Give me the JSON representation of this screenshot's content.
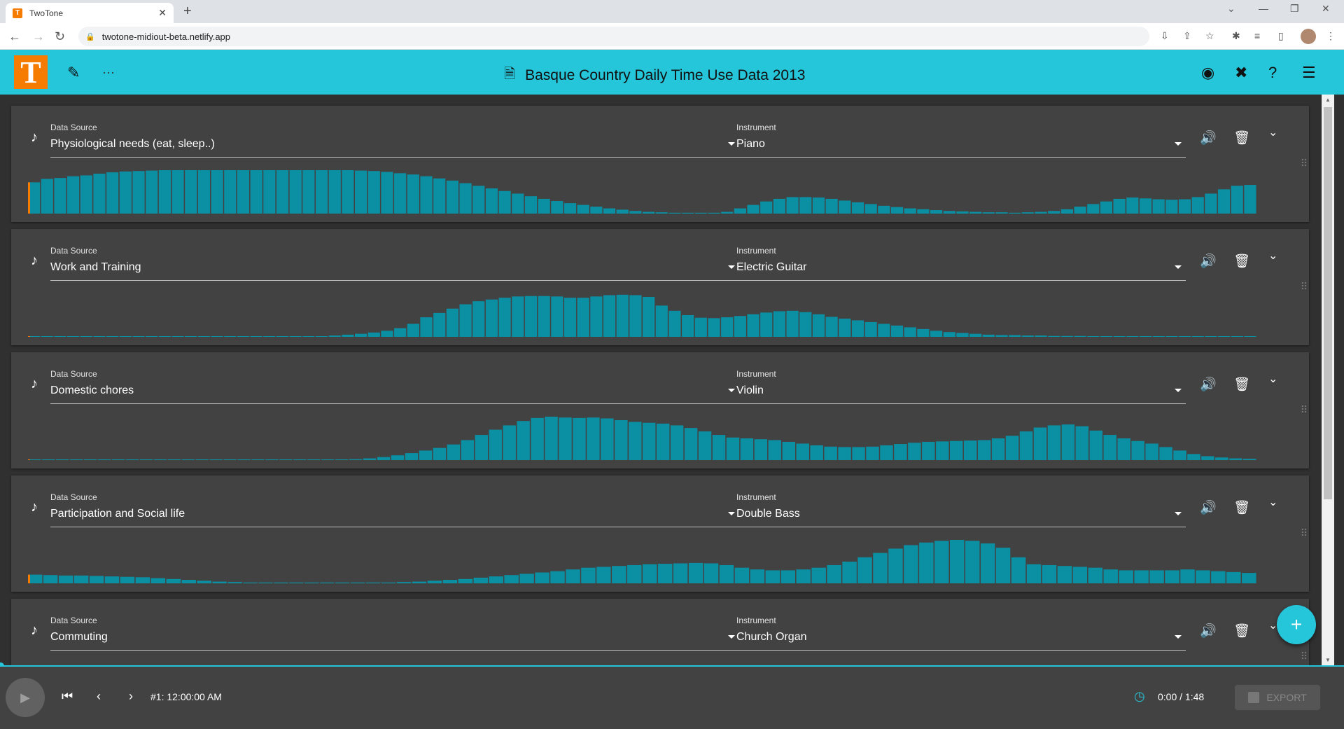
{
  "browser": {
    "tab_title": "TwoTone",
    "favicon_letter": "T",
    "url": "twotone-midiout-beta.netlify.app"
  },
  "app": {
    "title": "Basque Country Daily Time Use Data 2013",
    "accent_color": "#26c6da",
    "logo_color": "#f57c00",
    "bar_color": "#0b8fa3",
    "more_label": "···"
  },
  "tracks": [
    {
      "data_source_label": "Data Source",
      "data_source": "Physiological needs (eat, sleep..)",
      "instrument_label": "Instrument",
      "instrument": "Piano",
      "values": [
        0.72,
        0.8,
        0.82,
        0.86,
        0.88,
        0.92,
        0.95,
        0.97,
        0.98,
        0.99,
        1,
        1,
        1,
        1,
        1,
        1,
        1,
        1,
        1,
        1,
        1,
        1,
        1,
        1,
        1,
        0.99,
        0.98,
        0.96,
        0.93,
        0.9,
        0.86,
        0.81,
        0.76,
        0.7,
        0.64,
        0.58,
        0.52,
        0.46,
        0.4,
        0.34,
        0.29,
        0.24,
        0.2,
        0.16,
        0.12,
        0.09,
        0.06,
        0.04,
        0.03,
        0.02,
        0.02,
        0.02,
        0.02,
        0.04,
        0.12,
        0.2,
        0.28,
        0.34,
        0.38,
        0.38,
        0.37,
        0.34,
        0.3,
        0.26,
        0.22,
        0.18,
        0.15,
        0.12,
        0.1,
        0.08,
        0.06,
        0.05,
        0.04,
        0.03,
        0.03,
        0.02,
        0.03,
        0.04,
        0.06,
        0.1,
        0.16,
        0.22,
        0.28,
        0.34,
        0.37,
        0.35,
        0.33,
        0.32,
        0.33,
        0.38,
        0.46,
        0.56,
        0.64,
        0.66
      ]
    },
    {
      "data_source_label": "Data Source",
      "data_source": "Work and Training",
      "instrument_label": "Instrument",
      "instrument": "Electric Guitar",
      "values": [
        0.01,
        0.01,
        0.01,
        0.01,
        0.01,
        0.01,
        0.01,
        0.01,
        0.01,
        0.01,
        0.01,
        0.01,
        0.01,
        0.01,
        0.01,
        0.01,
        0.01,
        0.01,
        0.01,
        0.01,
        0.01,
        0.01,
        0.01,
        0.03,
        0.05,
        0.07,
        0.1,
        0.14,
        0.2,
        0.3,
        0.45,
        0.55,
        0.65,
        0.75,
        0.82,
        0.86,
        0.9,
        0.93,
        0.94,
        0.94,
        0.93,
        0.9,
        0.9,
        0.93,
        0.96,
        0.97,
        0.96,
        0.92,
        0.72,
        0.6,
        0.5,
        0.44,
        0.43,
        0.45,
        0.48,
        0.52,
        0.56,
        0.59,
        0.6,
        0.57,
        0.52,
        0.46,
        0.42,
        0.38,
        0.34,
        0.3,
        0.26,
        0.22,
        0.18,
        0.14,
        0.11,
        0.09,
        0.07,
        0.05,
        0.04,
        0.04,
        0.03,
        0.03,
        0.02,
        0.02,
        0.02,
        0.01,
        0.01,
        0.01,
        0.01,
        0.01,
        0.01,
        0.01,
        0.01,
        0.01,
        0.01,
        0.01,
        0.01,
        0.01
      ]
    },
    {
      "data_source_label": "Data Source",
      "data_source": "Domestic chores",
      "instrument_label": "Instrument",
      "instrument": "Violin",
      "values": [
        0.01,
        0.01,
        0.01,
        0.01,
        0.01,
        0.01,
        0.01,
        0.01,
        0.01,
        0.01,
        0.01,
        0.01,
        0.01,
        0.01,
        0.01,
        0.01,
        0.01,
        0.01,
        0.01,
        0.01,
        0.01,
        0.01,
        0.01,
        0.02,
        0.04,
        0.07,
        0.11,
        0.16,
        0.22,
        0.28,
        0.36,
        0.46,
        0.58,
        0.7,
        0.8,
        0.9,
        0.97,
        1,
        0.98,
        0.97,
        0.98,
        0.96,
        0.92,
        0.88,
        0.86,
        0.84,
        0.8,
        0.74,
        0.66,
        0.58,
        0.52,
        0.5,
        0.48,
        0.46,
        0.42,
        0.38,
        0.34,
        0.31,
        0.3,
        0.3,
        0.31,
        0.34,
        0.37,
        0.4,
        0.42,
        0.43,
        0.44,
        0.45,
        0.46,
        0.5,
        0.56,
        0.66,
        0.75,
        0.8,
        0.82,
        0.78,
        0.68,
        0.58,
        0.5,
        0.44,
        0.38,
        0.3,
        0.22,
        0.14,
        0.09,
        0.06,
        0.04,
        0.03
      ]
    },
    {
      "data_source_label": "Data Source",
      "data_source": "Participation and Social life",
      "instrument_label": "Instrument",
      "instrument": "Double Bass",
      "values": [
        0.2,
        0.19,
        0.18,
        0.18,
        0.17,
        0.16,
        0.15,
        0.14,
        0.12,
        0.1,
        0.08,
        0.06,
        0.04,
        0.03,
        0.02,
        0.02,
        0.02,
        0.02,
        0.02,
        0.02,
        0.02,
        0.02,
        0.02,
        0.02,
        0.03,
        0.04,
        0.06,
        0.08,
        0.1,
        0.13,
        0.16,
        0.19,
        0.22,
        0.25,
        0.28,
        0.32,
        0.36,
        0.38,
        0.4,
        0.42,
        0.44,
        0.45,
        0.46,
        0.47,
        0.46,
        0.42,
        0.36,
        0.32,
        0.3,
        0.3,
        0.32,
        0.36,
        0.42,
        0.5,
        0.6,
        0.7,
        0.8,
        0.88,
        0.94,
        0.98,
        1,
        0.98,
        0.92,
        0.82,
        0.6,
        0.44,
        0.42,
        0.4,
        0.38,
        0.36,
        0.32,
        0.3,
        0.3,
        0.3,
        0.3,
        0.32,
        0.3,
        0.28,
        0.26,
        0.24
      ]
    },
    {
      "data_source_label": "Data Source",
      "data_source": "Commuting",
      "instrument_label": "Instrument",
      "instrument": "Church Organ",
      "values": []
    }
  ],
  "player": {
    "step_info": "#1: 12:00:00 AM",
    "time": "0:00 / 1:48",
    "export_label": "EXPORT"
  }
}
